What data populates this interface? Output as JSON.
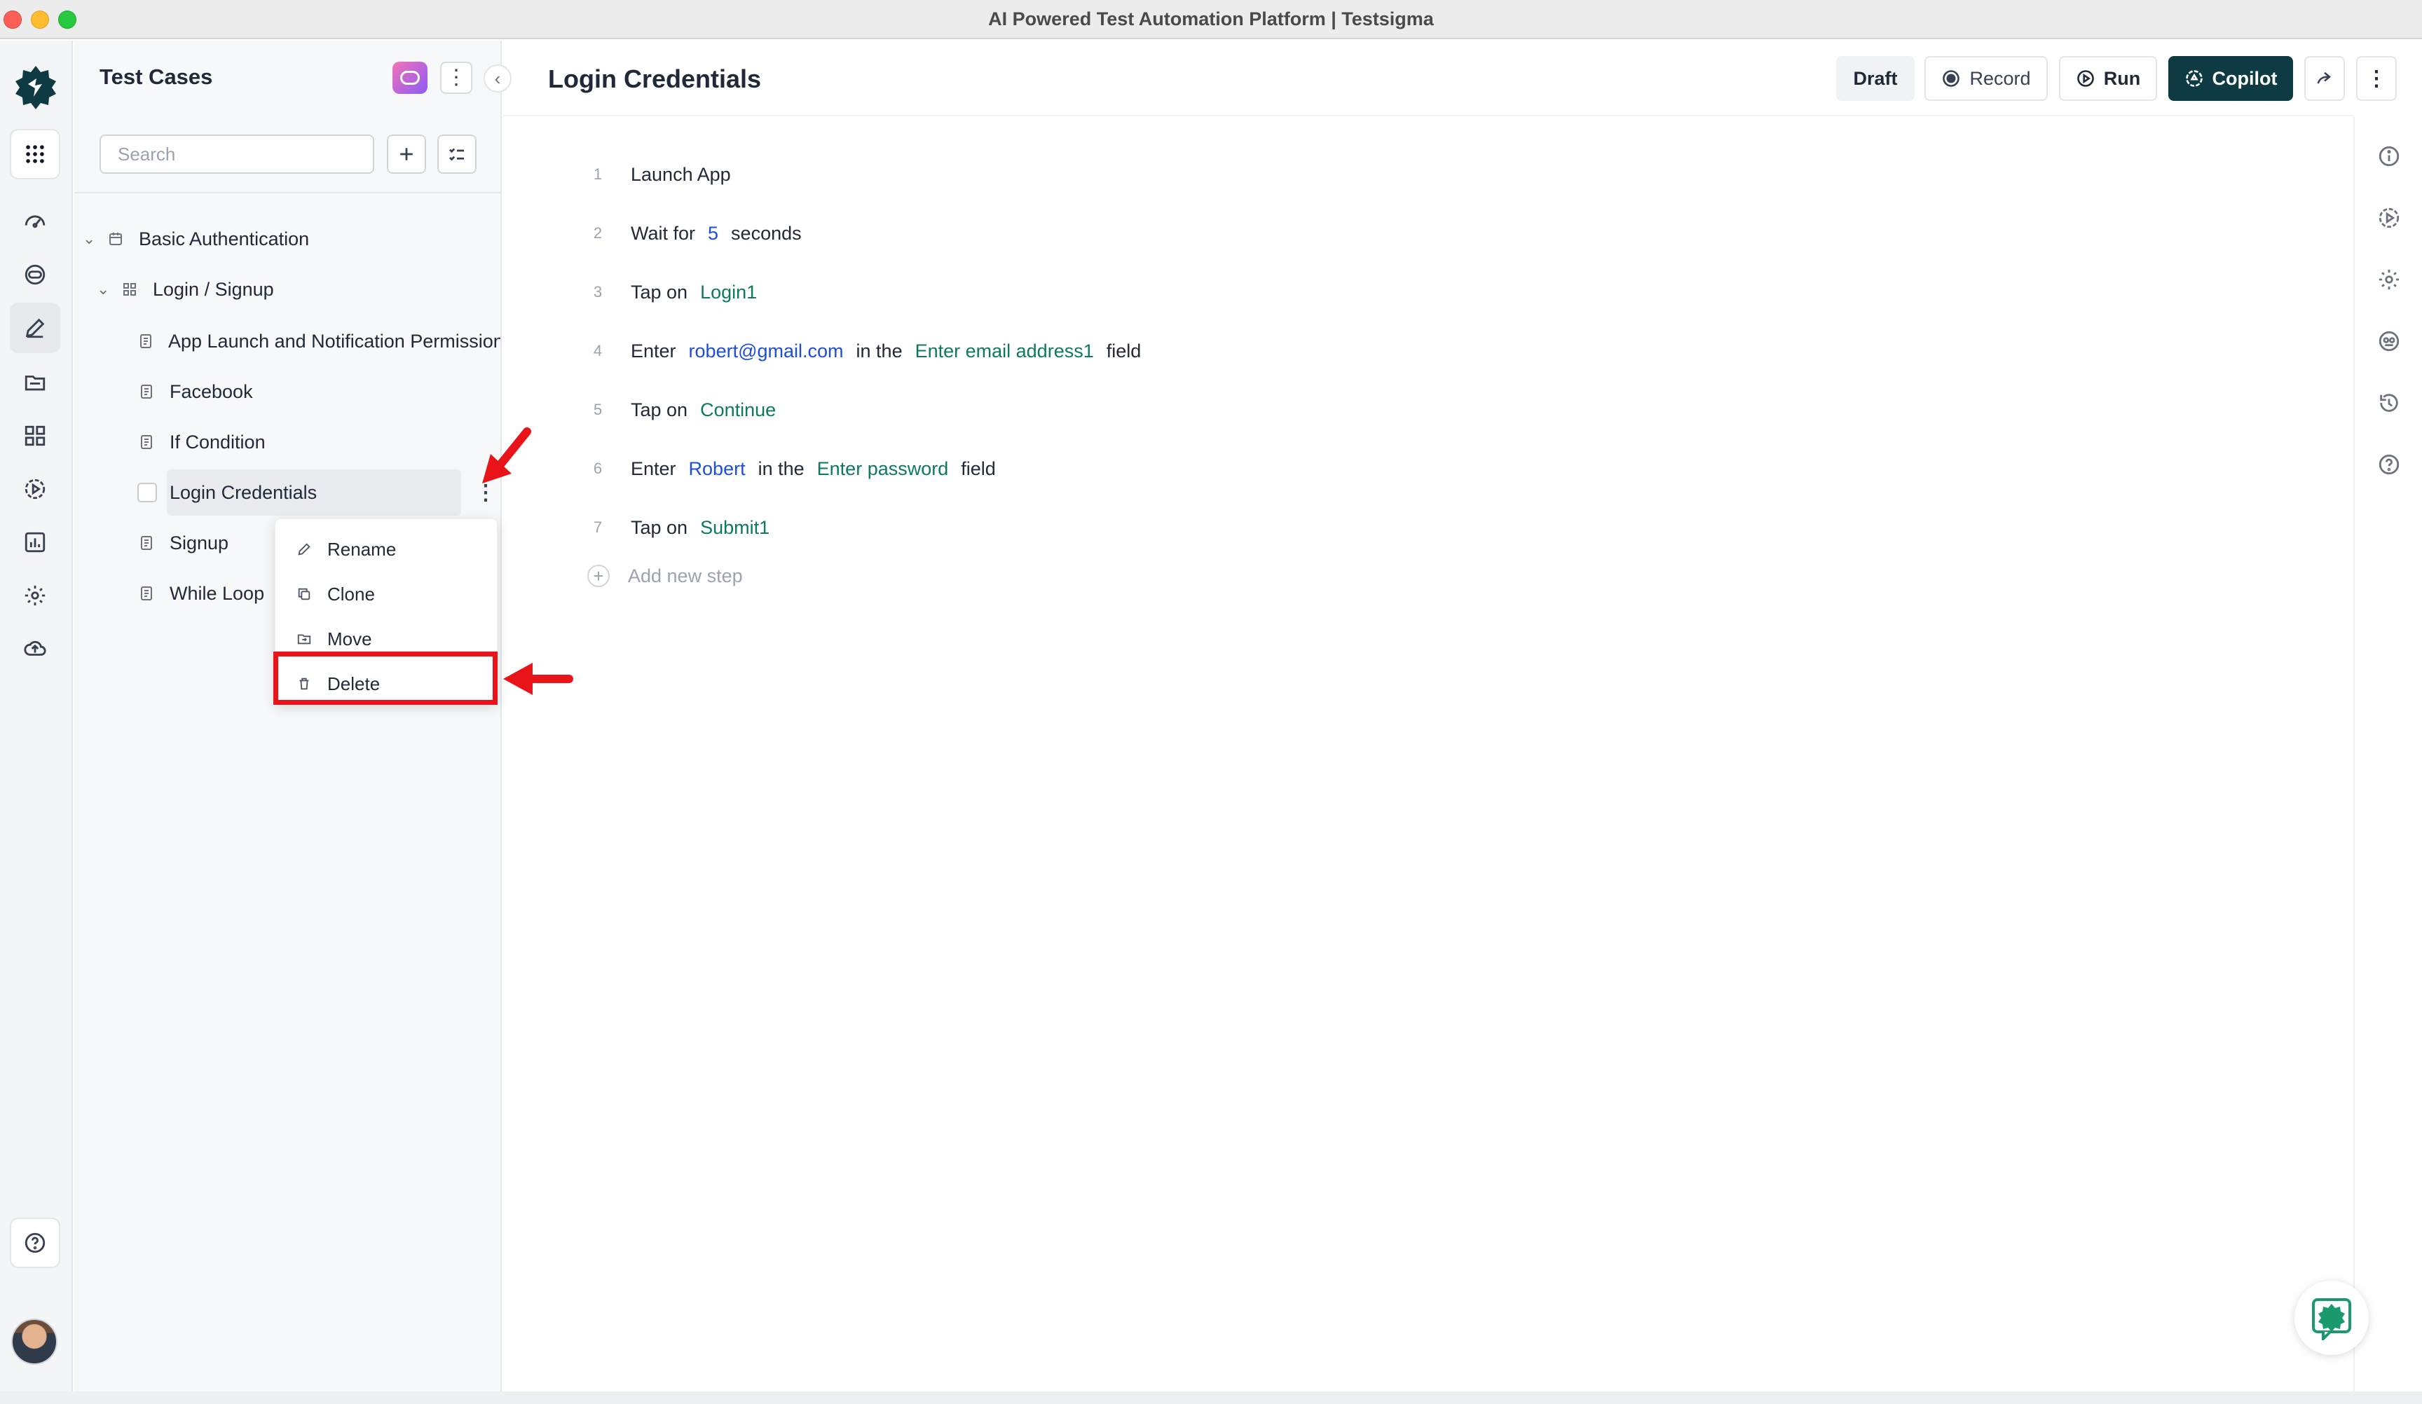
{
  "window": {
    "title": "AI Powered Test Automation Platform | Testsigma"
  },
  "rail": {
    "items": [
      {
        "name": "apps-grid-icon"
      },
      {
        "name": "dashboard-icon"
      },
      {
        "name": "agent-icon"
      },
      {
        "name": "test-cases-icon"
      },
      {
        "name": "test-data-icon"
      },
      {
        "name": "elements-icon"
      },
      {
        "name": "runs-icon"
      },
      {
        "name": "reports-icon"
      },
      {
        "name": "settings-icon"
      },
      {
        "name": "cloud-upload-icon"
      },
      {
        "name": "help-icon"
      }
    ]
  },
  "panel": {
    "title": "Test Cases",
    "search_placeholder": "Search",
    "tree": {
      "suite": "Basic Authentication",
      "group": "Login / Signup",
      "cases": [
        "App Launch and Notification Permission",
        "Facebook",
        "If Condition",
        "Login Credentials",
        "Signup",
        "While Loop"
      ]
    }
  },
  "context_menu": {
    "items": [
      {
        "label": "Rename",
        "icon": "pencil-icon"
      },
      {
        "label": "Clone",
        "icon": "copy-icon"
      },
      {
        "label": "Move",
        "icon": "folder-move-icon"
      },
      {
        "label": "Delete",
        "icon": "trash-icon"
      }
    ]
  },
  "header": {
    "title": "Login Credentials",
    "draft_label": "Draft",
    "record_label": "Record",
    "run_label": "Run",
    "copilot_label": "Copilot"
  },
  "steps": [
    {
      "num": "1",
      "tokens": [
        {
          "t": "Launch App",
          "k": "plain"
        }
      ]
    },
    {
      "num": "2",
      "tokens": [
        {
          "t": "Wait for",
          "k": "plain"
        },
        {
          "t": "5",
          "k": "num"
        },
        {
          "t": "seconds",
          "k": "plain"
        }
      ]
    },
    {
      "num": "3",
      "tokens": [
        {
          "t": "Tap on",
          "k": "plain"
        },
        {
          "t": "Login1",
          "k": "elem"
        }
      ]
    },
    {
      "num": "4",
      "tokens": [
        {
          "t": "Enter",
          "k": "plain"
        },
        {
          "t": "robert@gmail.com",
          "k": "data"
        },
        {
          "t": "in the",
          "k": "plain"
        },
        {
          "t": "Enter email address1",
          "k": "elem"
        },
        {
          "t": "field",
          "k": "plain"
        }
      ]
    },
    {
      "num": "5",
      "tokens": [
        {
          "t": "Tap on",
          "k": "plain"
        },
        {
          "t": "Continue",
          "k": "elem"
        }
      ]
    },
    {
      "num": "6",
      "tokens": [
        {
          "t": "Enter",
          "k": "plain"
        },
        {
          "t": "Robert",
          "k": "data"
        },
        {
          "t": "in the",
          "k": "plain"
        },
        {
          "t": "Enter password",
          "k": "elem"
        },
        {
          "t": "field",
          "k": "plain"
        }
      ]
    },
    {
      "num": "7",
      "tokens": [
        {
          "t": "Tap on",
          "k": "plain"
        },
        {
          "t": "Submit1",
          "k": "elem"
        }
      ]
    }
  ],
  "add_step_label": "Add new step",
  "colors": {
    "element": "#0d7a5f",
    "data": "#1d4ed8",
    "copilot_bg": "#0e3b43",
    "annotation": "#e8141a"
  }
}
